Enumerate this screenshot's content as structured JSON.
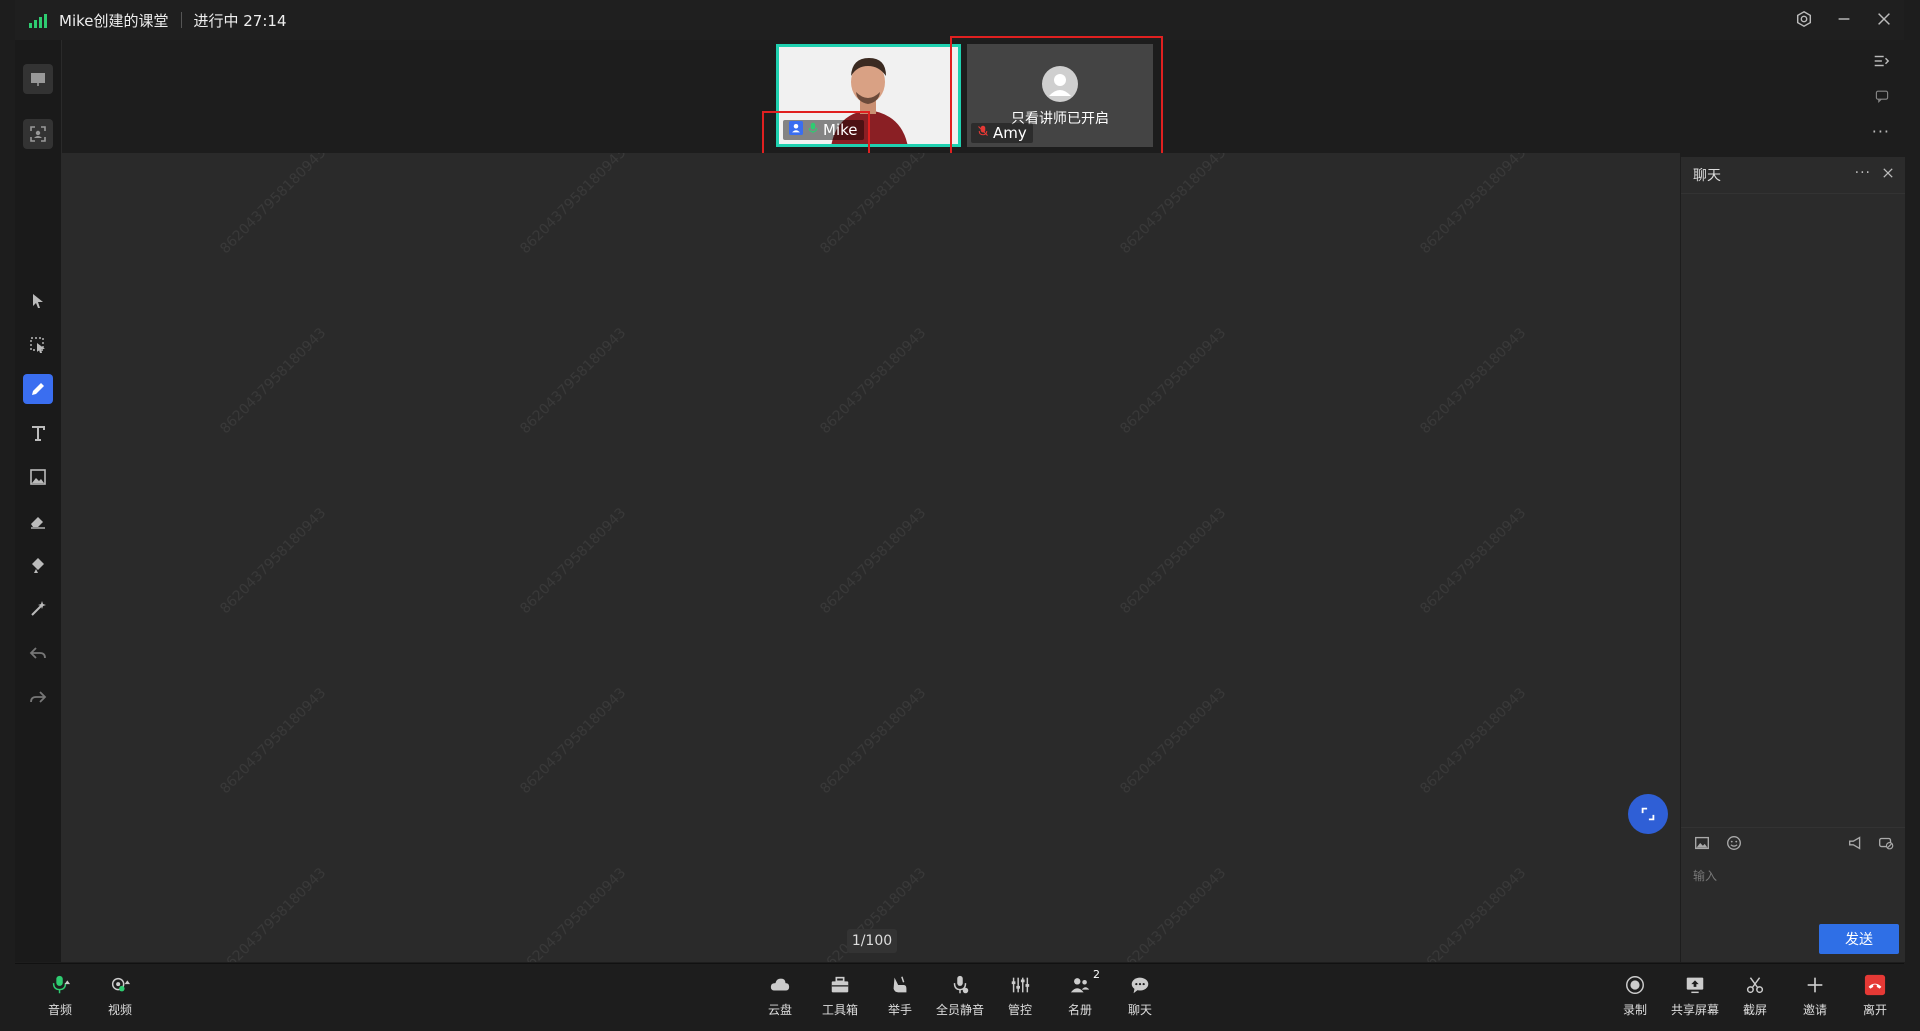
{
  "title": {
    "room_name": "Mike创建的课堂",
    "status": "进行中 27:14"
  },
  "participants": [
    {
      "name": "Mike",
      "role": "teacher"
    },
    {
      "name": "Amy",
      "notice": "只看讲师已开启"
    }
  ],
  "watermark": "8620437958180943",
  "stage": {
    "page_counter": "1/100"
  },
  "chat": {
    "title": "聊天",
    "input_placeholder": "输入",
    "send_label": "发送"
  },
  "bottom_left": [
    {
      "label": "音频",
      "icon": "mic-icon"
    },
    {
      "label": "视频",
      "icon": "camera-icon"
    }
  ],
  "bottom_center": [
    {
      "label": "云盘",
      "icon": "cloud-icon"
    },
    {
      "label": "工具箱",
      "icon": "toolbox-icon"
    },
    {
      "label": "举手",
      "icon": "hand-icon"
    },
    {
      "label": "全员静音",
      "icon": "mute-all-icon"
    },
    {
      "label": "管控",
      "icon": "controls-icon"
    },
    {
      "label": "名册",
      "icon": "roster-icon",
      "badge": "2"
    },
    {
      "label": "聊天",
      "icon": "chat-icon"
    }
  ],
  "bottom_right": [
    {
      "label": "录制",
      "icon": "record-icon"
    },
    {
      "label": "共享屏幕",
      "icon": "share-screen-icon"
    },
    {
      "label": "截屏",
      "icon": "screenshot-icon"
    },
    {
      "label": "邀请",
      "icon": "invite-icon"
    },
    {
      "label": "离开",
      "icon": "leave-icon"
    }
  ],
  "colors": {
    "accent": "#2f6fe6",
    "speaker_border": "#1fd1b0",
    "danger": "#e53935"
  }
}
